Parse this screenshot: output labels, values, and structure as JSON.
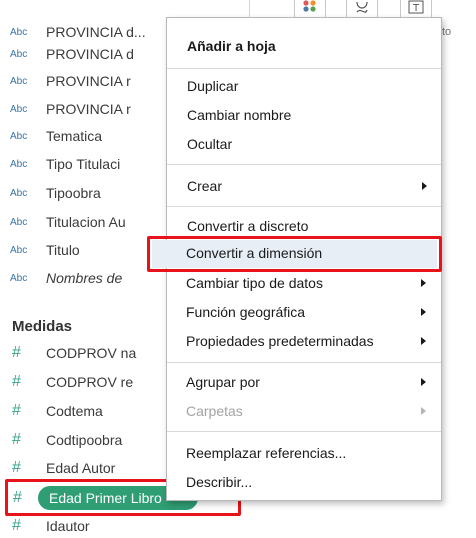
{
  "dimensions": [
    {
      "type": "Abc",
      "name": "PROVINCIA d..."
    },
    {
      "type": "Abc",
      "name": "PROVINCIA d"
    },
    {
      "type": "Abc",
      "name": "PROVINCIA r"
    },
    {
      "type": "Abc",
      "name": "PROVINCIA r"
    },
    {
      "type": "Abc",
      "name": "Tematica"
    },
    {
      "type": "Abc",
      "name": "Tipo Titulaci"
    },
    {
      "type": "Abc",
      "name": "Tipoobra"
    },
    {
      "type": "Abc",
      "name": "Titulacion Au"
    },
    {
      "type": "Abc",
      "name": "Titulo"
    },
    {
      "type": "Abc",
      "name": "Nombres de"
    }
  ],
  "measures_title": "Medidas",
  "measures": [
    {
      "type": "#",
      "name": "CODPROV na"
    },
    {
      "type": "#",
      "name": "CODPROV re"
    },
    {
      "type": "#",
      "name": "Codtema"
    },
    {
      "type": "#",
      "name": "Codtipoobra"
    },
    {
      "type": "#",
      "name": "Edad Autor"
    },
    {
      "type": "#",
      "name": "Edad Primer"
    },
    {
      "type": "#",
      "name": "Idautor"
    }
  ],
  "selected_pill": "Edad Primer Libro",
  "toolbar": {
    "text_label": "to"
  },
  "menu": {
    "items": [
      {
        "label": "Añadir a hoja",
        "bold": true
      },
      {
        "label": "Duplicar"
      },
      {
        "label": "Cambiar nombre"
      },
      {
        "label": "Ocultar"
      },
      {
        "label": "Crear",
        "submenu": true
      },
      {
        "label": "Convertir a discreto"
      },
      {
        "label": "Convertir a dimensión",
        "highlighted": true
      },
      {
        "label": "Cambiar tipo de datos",
        "submenu": true
      },
      {
        "label": "Función geográfica",
        "submenu": true
      },
      {
        "label": "Propiedades predeterminadas",
        "submenu": true
      },
      {
        "label": "Agrupar por",
        "submenu": true
      },
      {
        "label": "Carpetas",
        "submenu": true,
        "disabled": true
      },
      {
        "label": "Reemplazar referencias..."
      },
      {
        "label": "Describir..."
      }
    ]
  },
  "colors": {
    "accent_red": "#e8121a",
    "pill_green": "#2f9e74",
    "abc_blue": "#3b73a6",
    "measure_green": "#3aa48c"
  }
}
